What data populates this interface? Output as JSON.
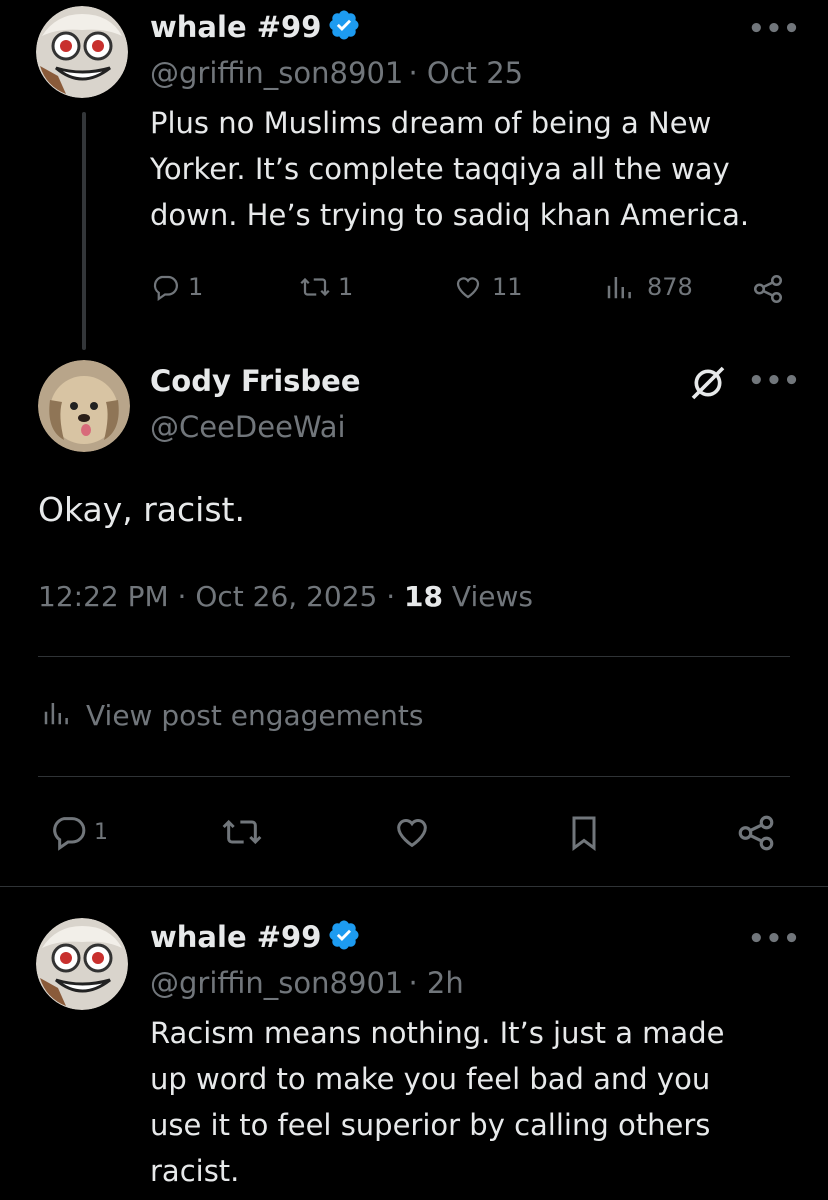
{
  "tweet1": {
    "name": "whale #99",
    "handle": "@griffin_son8901",
    "time": "· Oct 25",
    "lines": [
      "Plus no Muslims dream of being a New",
      "Yorker. It’s complete taqqiya all the way",
      "down. He’s trying to sadiq khan America."
    ],
    "replies": "1",
    "reposts": "1",
    "likes": "11",
    "views": "878"
  },
  "main": {
    "name": "Cody Frisbee",
    "handle": "@CeeDeeWai",
    "text": "Okay, racist.",
    "timestamp": "12:22 PM · Oct 26, 2025 ·",
    "views_count": "18",
    "views_label": "Views",
    "engagements": "View post engagements",
    "replies": "1"
  },
  "tweet3": {
    "name": "whale #99",
    "handle": "@griffin_son8901",
    "time": "· 2h",
    "lines": [
      "Racism means nothing. It’s just a made",
      "up word to make you feel bad and you",
      "use it to feel superior by calling others",
      "racist."
    ]
  },
  "more_glyph": "•••",
  "colors": {
    "bg": "#000000",
    "text": "#e7e9ea",
    "muted": "#71767b",
    "verified": "#1d9bf0",
    "divider": "#2f3336"
  },
  "icons": [
    "reply-icon",
    "repost-icon",
    "like-icon",
    "views-icon",
    "share-icon",
    "bookmark-icon",
    "verified-badge-icon",
    "grok-icon",
    "more-icon"
  ]
}
